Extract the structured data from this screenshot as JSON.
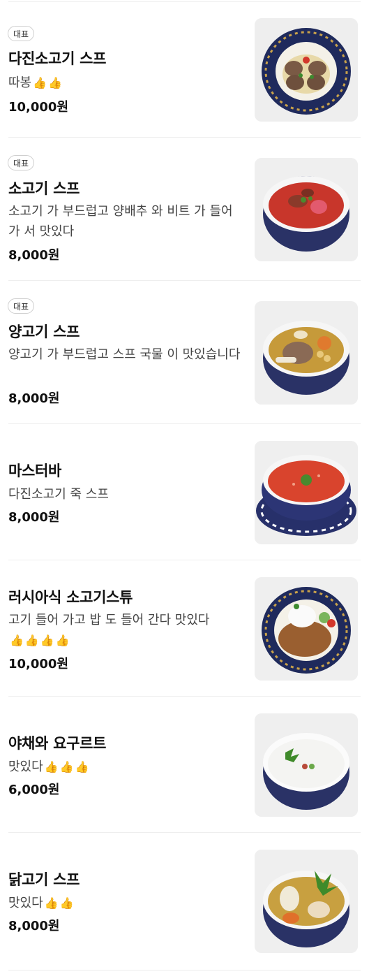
{
  "items": [
    {
      "badge": "대표",
      "name": "다진소고기 스프",
      "desc": "따봉",
      "emojis": [
        "👍",
        "👍"
      ],
      "price": "10,000원"
    },
    {
      "badge": "대표",
      "name": "소고기 스프",
      "desc": "소고기 가 부드럽고 양배추 와 비트 가 들어가 서 맛있다",
      "emojis": [],
      "price": "8,000원"
    },
    {
      "badge": "대표",
      "name": "양고기 스프",
      "desc": "양고기 가 부드럽고 스프 국물 이 맛있습니다",
      "emojis": [],
      "price": "8,000원"
    },
    {
      "name": "마스터바",
      "desc": "다진소고기 죽 스프",
      "emojis": [],
      "price": "8,000원"
    },
    {
      "name": "러시아식 소고기스튜",
      "desc": "고기 들어 가고 밥 도 들어 간다 맛있다",
      "emojis": [
        "👍",
        "👍",
        "👍",
        "👍"
      ],
      "price": "10,000원"
    },
    {
      "name": "야채와 요구르트",
      "desc": "맛있다",
      "emojis": [
        "👍",
        "👍",
        "👍"
      ],
      "price": "6,000원"
    },
    {
      "name": "닭고기 스프",
      "desc": "맛있다",
      "emojis": [
        "👍",
        "👍"
      ],
      "price": "8,000원"
    }
  ]
}
